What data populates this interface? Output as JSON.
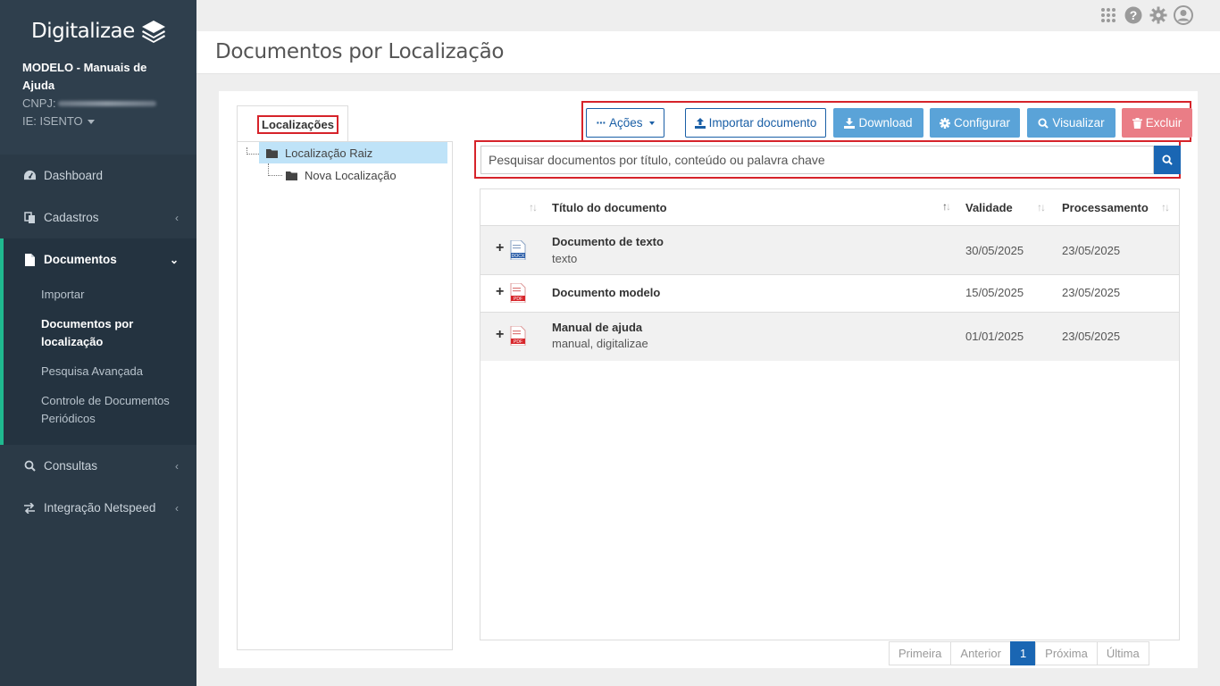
{
  "brand": {
    "name": "Digitalizae"
  },
  "company": {
    "name": "MODELO - Manuais de Ajuda",
    "cnpj_label": "CNPJ:",
    "ie_label": "IE: ISENTO"
  },
  "sidebar": {
    "items": [
      {
        "label": "Dashboard",
        "icon": "dashboard-icon"
      },
      {
        "label": "Cadastros",
        "icon": "copy-icon"
      },
      {
        "label": "Documentos",
        "icon": "file-icon"
      },
      {
        "label": "Consultas",
        "icon": "search-icon"
      },
      {
        "label": "Integração Netspeed",
        "icon": "exchange-icon"
      }
    ],
    "documentos_sub": [
      {
        "label": "Importar"
      },
      {
        "label": "Documentos por localização"
      },
      {
        "label": "Pesquisa Avançada"
      },
      {
        "label": "Controle de Documentos Periódicos"
      }
    ]
  },
  "page": {
    "title": "Documentos por Localização"
  },
  "tree": {
    "tab_label": "Localizações",
    "root": "Localização Raiz",
    "child": "Nova Localização"
  },
  "toolbar": {
    "acoes": "Ações",
    "importar": "Importar documento",
    "download": "Download",
    "configurar": "Configurar",
    "visualizar": "Visualizar",
    "excluir": "Excluir"
  },
  "search": {
    "placeholder": "Pesquisar documentos por título, conteúdo ou palavra chave"
  },
  "table": {
    "headers": {
      "titulo": "Título do documento",
      "validade": "Validade",
      "processamento": "Processamento"
    },
    "rows": [
      {
        "title": "Documento de texto",
        "keywords": "texto",
        "validade": "30/05/2025",
        "processamento": "23/05/2025",
        "type": "doc"
      },
      {
        "title": "Documento modelo",
        "keywords": "",
        "validade": "15/05/2025",
        "processamento": "23/05/2025",
        "type": "pdf"
      },
      {
        "title": "Manual de ajuda",
        "keywords": "manual, digitalizae",
        "validade": "01/01/2025",
        "processamento": "23/05/2025",
        "type": "pdf"
      }
    ]
  },
  "pagination": {
    "first": "Primeira",
    "prev": "Anterior",
    "current": "1",
    "next": "Próxima",
    "last": "Última"
  },
  "colors": {
    "sidebar": "#2b3a47",
    "accent": "#1fb98f",
    "primary": "#1a66b3",
    "highlight": "#d6232a"
  }
}
